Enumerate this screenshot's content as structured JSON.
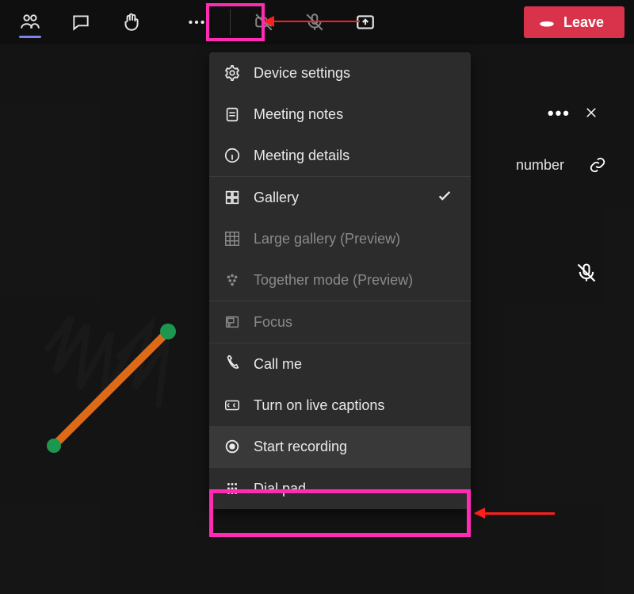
{
  "toolbar": {
    "leave_label": "Leave"
  },
  "right_panel": {
    "number_text": "number"
  },
  "menu": {
    "device_settings": "Device settings",
    "meeting_notes": "Meeting notes",
    "meeting_details": "Meeting details",
    "gallery": "Gallery",
    "large_gallery": "Large gallery (Preview)",
    "together_mode": "Together mode (Preview)",
    "focus": "Focus",
    "call_me": "Call me",
    "live_captions": "Turn on live captions",
    "start_recording": "Start recording",
    "dial_pad": "Dial pad"
  }
}
